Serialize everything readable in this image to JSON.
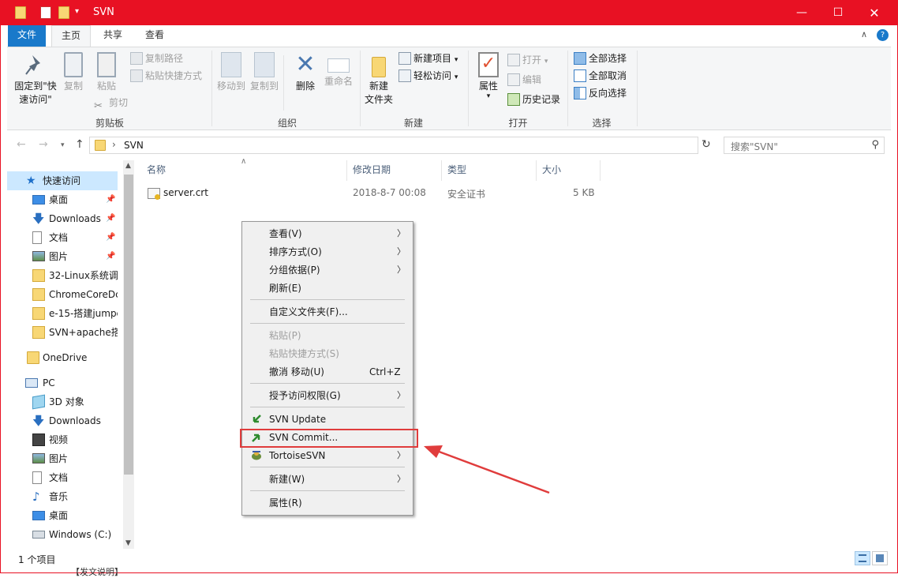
{
  "window": {
    "title": "SVN"
  },
  "ribbon_tabs": {
    "file": "文件",
    "home": "主页",
    "share": "共享",
    "view": "查看"
  },
  "ribbon": {
    "clipboard": {
      "pin_line1": "固定到\"快",
      "pin_line2": "速访问\"",
      "copy": "复制",
      "paste": "粘贴",
      "copy_path": "复制路径",
      "paste_shortcut": "粘贴快捷方式",
      "cut": "剪切",
      "label": "剪贴板"
    },
    "organize": {
      "move_to": "移动到",
      "copy_to": "复制到",
      "delete": "删除",
      "rename": "重命名",
      "label": "组织"
    },
    "new": {
      "new_folder_line1": "新建",
      "new_folder_line2": "文件夹",
      "new_item": "新建项目",
      "easy_access": "轻松访问",
      "label": "新建"
    },
    "open": {
      "properties": "属性",
      "open": "打开",
      "edit": "编辑",
      "history": "历史记录",
      "label": "打开"
    },
    "select": {
      "select_all": "全部选择",
      "select_none": "全部取消",
      "invert": "反向选择",
      "label": "选择"
    }
  },
  "address": {
    "path": "SVN",
    "search_placeholder": "搜索\"SVN\""
  },
  "nav": {
    "quick_access": "快速访问",
    "items": [
      {
        "label": "桌面",
        "icon": "desktop-icon",
        "pinned": true
      },
      {
        "label": "Downloads",
        "icon": "download-icon",
        "pinned": true
      },
      {
        "label": "文档",
        "icon": "document-icon",
        "pinned": true
      },
      {
        "label": "图片",
        "icon": "pictures-icon",
        "pinned": true
      },
      {
        "label": "32-Linux系统调",
        "icon": "folder-icon"
      },
      {
        "label": "ChromeCoreDc",
        "icon": "folder-icon"
      },
      {
        "label": "e-15-搭建jumpe",
        "icon": "folder-icon"
      },
      {
        "label": "SVN+apache搭",
        "icon": "folder-icon"
      }
    ],
    "onedrive": "OneDrive",
    "pc": "PC",
    "pc_items": [
      {
        "label": "3D 对象",
        "icon": "3d-objects-icon"
      },
      {
        "label": "Downloads",
        "icon": "download-icon"
      },
      {
        "label": "视频",
        "icon": "video-icon"
      },
      {
        "label": "图片",
        "icon": "pictures-icon"
      },
      {
        "label": "文档",
        "icon": "document-icon"
      },
      {
        "label": "音乐",
        "icon": "music-icon"
      },
      {
        "label": "桌面",
        "icon": "desktop-icon"
      },
      {
        "label": "Windows (C:)",
        "icon": "drive-icon"
      }
    ]
  },
  "columns": {
    "name": "名称",
    "modified": "修改日期",
    "type": "类型",
    "size": "大小"
  },
  "files": [
    {
      "name": "server.crt",
      "modified": "2018-8-7 00:08",
      "type": "安全证书",
      "size": "5 KB"
    }
  ],
  "status": {
    "count": "1 个项目",
    "below_text": "【发文说明】"
  },
  "context_menu": {
    "view": "查看(V)",
    "sort": "排序方式(O)",
    "group": "分组依据(P)",
    "refresh": "刷新(E)",
    "customize": "自定义文件夹(F)...",
    "paste": "粘贴(P)",
    "paste_shortcut": "粘贴快捷方式(S)",
    "undo": "撤消 移动(U)",
    "undo_shortcut": "Ctrl+Z",
    "grant_access": "授予访问权限(G)",
    "svn_update": "SVN Update",
    "svn_commit": "SVN Commit...",
    "tortoise": "TortoiseSVN",
    "new": "新建(W)",
    "properties": "属性(R)"
  },
  "colors": {
    "accent": "#e81123",
    "selection": "#cce8ff",
    "annotation": "#e03c3c"
  }
}
